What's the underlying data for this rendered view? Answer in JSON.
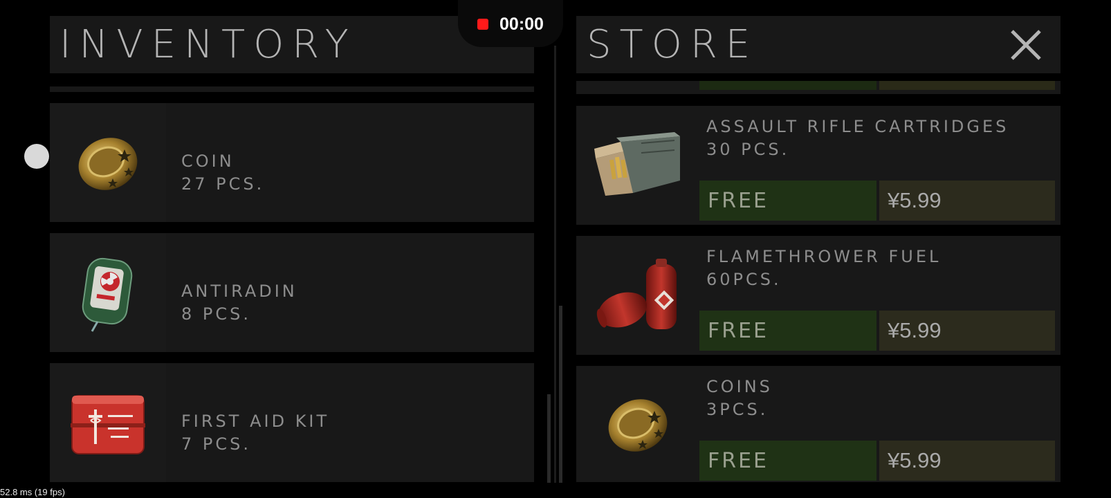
{
  "overlay": {
    "recording_time": "00:00",
    "fps_readout": "52.8 ms (19 fps)"
  },
  "inventory": {
    "title": "INVENTORY",
    "items": [
      {
        "name": "COIN",
        "qty": "27 PCS.",
        "icon": "coin-icon"
      },
      {
        "name": "ANTIRADIN",
        "qty": "8 PCS.",
        "icon": "antiradin-icon"
      },
      {
        "name": "FIRST AID KIT",
        "qty": "7 PCS.",
        "icon": "first-aid-kit-icon"
      }
    ]
  },
  "store": {
    "title": "STORE",
    "close_icon": "close-icon",
    "items": [
      {
        "name": "ASSAULT RIFLE CARTRIDGES",
        "qty": "30 PCS.",
        "free_label": "FREE",
        "price": "¥5.99",
        "icon": "ammo-box-icon"
      },
      {
        "name": "FLAMETHROWER FUEL",
        "qty": "60PCS.",
        "free_label": "FREE",
        "price": "¥5.99",
        "icon": "fuel-canister-icon"
      },
      {
        "name": "COINS",
        "qty": "3PCS.",
        "free_label": "FREE",
        "price": "¥5.99",
        "icon": "coin-icon"
      }
    ]
  },
  "colors": {
    "free_button": "#1f3215",
    "price_button": "#2c2b1d",
    "record_dot": "#ff1a1a"
  }
}
